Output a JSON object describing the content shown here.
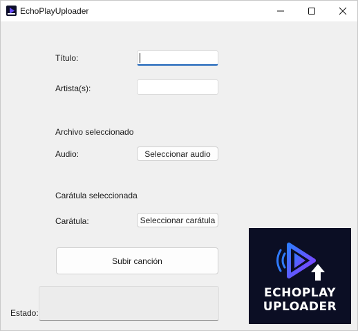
{
  "window": {
    "title": "EchoPlayUploader"
  },
  "form": {
    "titulo_label": "Título:",
    "titulo_value": "",
    "artista_label": "Artista(s):",
    "artista_value": "",
    "archivo_seleccionado": "Archivo seleccionado",
    "audio_label": "Audio:",
    "seleccionar_audio": "Seleccionar audio",
    "caratula_seleccionada": "Carátula seleccionada",
    "caratula_label": "Carátula:",
    "seleccionar_caratula": "Seleccionar carátula",
    "subir_cancion": "Subir canción",
    "estado_label": "Estado:",
    "estado_value": ""
  },
  "logo": {
    "line1": "ECHOPLAY",
    "line2": "UPLOADER",
    "icon": "play-upload-icon"
  },
  "colors": {
    "accent": "#1a62b8",
    "logo_bg": "#0b0e24",
    "logo_purple": "#7b3cff",
    "logo_blue": "#2f7bff"
  }
}
